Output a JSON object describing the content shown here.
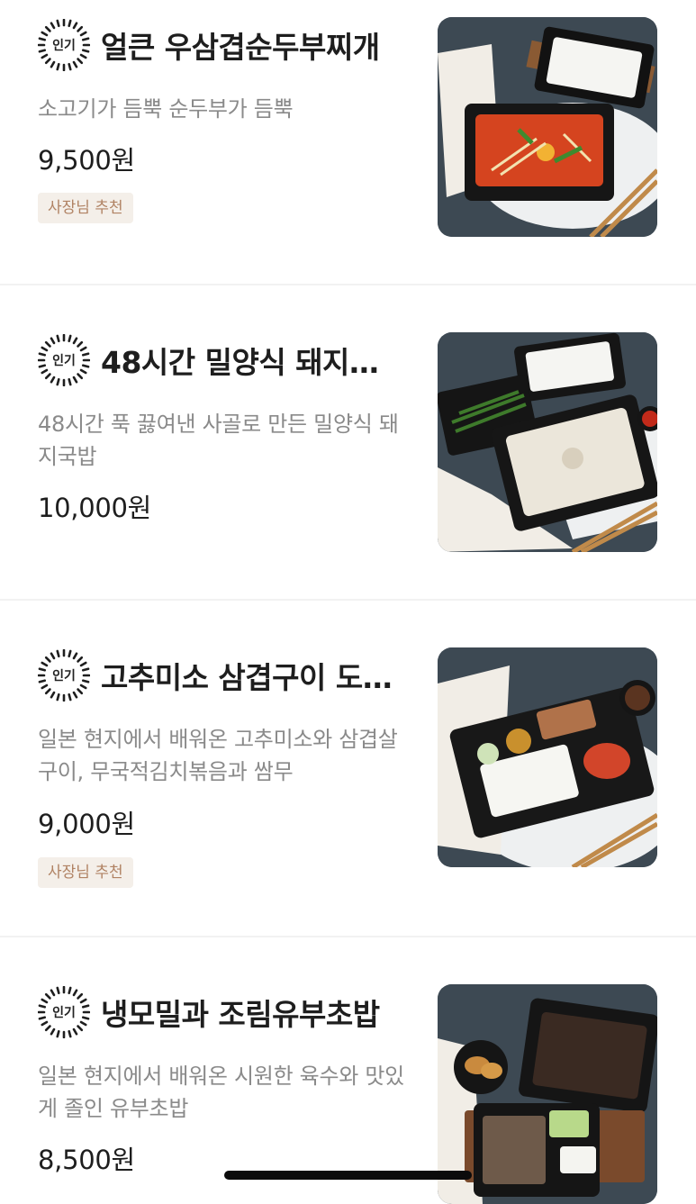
{
  "menu": [
    {
      "popular_badge": "인기",
      "name": "얼큰 우삼겹순두부찌개",
      "description": "소고기가 듬뿍  순두부가 듬뿍",
      "price": "9,500원",
      "owner_badge": "사장님 추천"
    },
    {
      "popular_badge": "인기",
      "name": "48시간 밀양식 돼지…",
      "description": "48시간 푹 끓여낸 사골로 만든 밀양식 돼지국밥",
      "price": "10,000원"
    },
    {
      "popular_badge": "인기",
      "name": "고추미소 삼겹구이 도…",
      "description": "일본 현지에서 배워온 고추미소와 삼겹살구이, 무국적김치볶음과 쌈무",
      "price": "9,000원",
      "owner_badge": "사장님 추천"
    },
    {
      "popular_badge": "인기",
      "name": "냉모밀과 조림유부초밥",
      "description": "일본 현지에서 배워온 시원한 육수와 맛있게 졸인 유부초밥",
      "price": "8,500원"
    }
  ],
  "colors": {
    "owner_badge_bg": "#f4efe9",
    "owner_badge_text": "#b08263",
    "description_text": "#8a8a8a",
    "divider": "#f2f2f2"
  },
  "icons": {
    "popular": "sunburst-badge-icon"
  }
}
